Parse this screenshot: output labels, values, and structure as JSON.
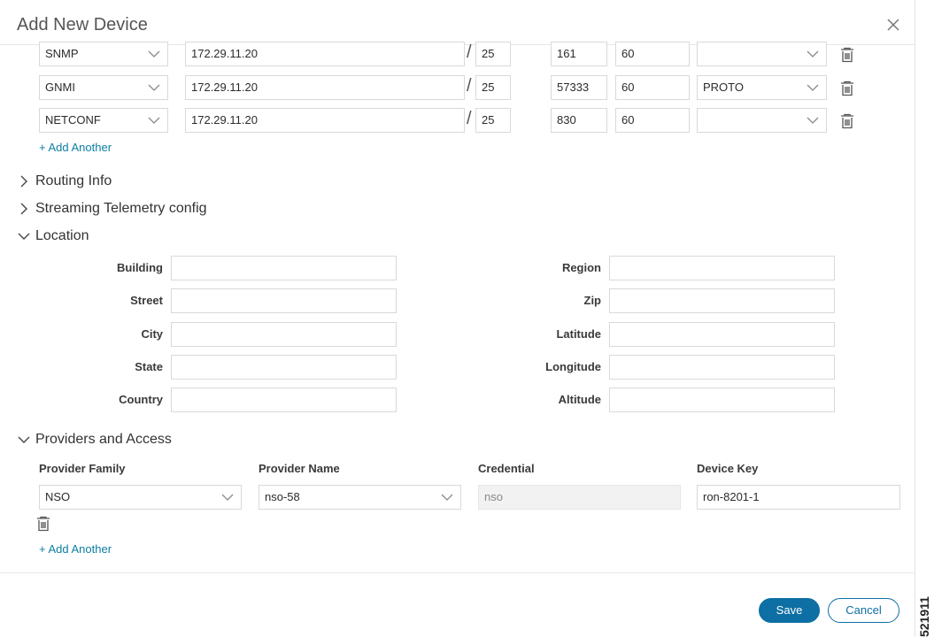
{
  "dialog": {
    "title": "Add New Device",
    "close_icon": "close-icon"
  },
  "connectivity": {
    "rows": [
      {
        "protocol": "SNMP",
        "ip": "172.29.11.20",
        "mask": "25",
        "port": "161",
        "timeout": "60",
        "encoding": ""
      },
      {
        "protocol": "GNMI",
        "ip": "172.29.11.20",
        "mask": "25",
        "port": "57333",
        "timeout": "60",
        "encoding": "PROTO"
      },
      {
        "protocol": "NETCONF",
        "ip": "172.29.11.20",
        "mask": "25",
        "port": "830",
        "timeout": "60",
        "encoding": ""
      }
    ],
    "slash": "/",
    "add_another": "+ Add Another"
  },
  "sections": {
    "routing": "Routing Info",
    "telemetry": "Streaming Telemetry config",
    "location": "Location",
    "providers": "Providers and Access"
  },
  "location": {
    "left": [
      {
        "label": "Building",
        "value": ""
      },
      {
        "label": "Street",
        "value": ""
      },
      {
        "label": "City",
        "value": ""
      },
      {
        "label": "State",
        "value": ""
      },
      {
        "label": "Country",
        "value": ""
      }
    ],
    "right": [
      {
        "label": "Region",
        "value": ""
      },
      {
        "label": "Zip",
        "value": ""
      },
      {
        "label": "Latitude",
        "value": ""
      },
      {
        "label": "Longitude",
        "value": ""
      },
      {
        "label": "Altitude",
        "value": ""
      }
    ]
  },
  "providers": {
    "headers": {
      "family": "Provider Family",
      "name": "Provider Name",
      "credential": "Credential",
      "device_key": "Device Key"
    },
    "row": {
      "family": "NSO",
      "name": "nso-58",
      "credential": "nso",
      "device_key": "ron-8201-1"
    },
    "add_another": "+ Add Another"
  },
  "footer": {
    "save": "Save",
    "cancel": "Cancel"
  },
  "figure_code": "521911",
  "colors": {
    "accent": "#0d6fa3",
    "link": "#0d7ea3"
  }
}
